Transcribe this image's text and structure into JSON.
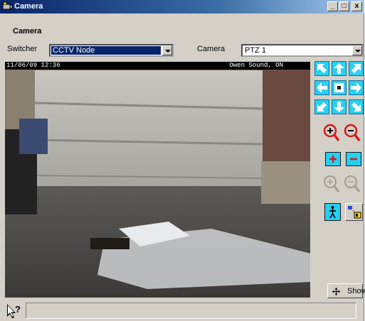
{
  "window": {
    "title": "Camera",
    "min_label": "_",
    "max_label": "□",
    "close_label": "x"
  },
  "header": {
    "section_title": "Camera"
  },
  "controls": {
    "switcher_label": "Switcher",
    "switcher_value": "CCTV Node",
    "camera_label": "Camera",
    "camera_value": "PTZ 1"
  },
  "video": {
    "timestamp": "11/06/09 12:36",
    "location": "Owen Sound, ON"
  },
  "buttons": {
    "show_label": "Show"
  },
  "colors": {
    "ptz_button": "#2ad0f0",
    "zoom_icon": "#d81818",
    "title_bar": "#0a246a"
  },
  "icons": {
    "pan": [
      "arrow-up-left",
      "arrow-up",
      "arrow-up-right",
      "arrow-left",
      "home",
      "arrow-right",
      "arrow-down-left",
      "arrow-down",
      "arrow-down-right"
    ],
    "zoom": [
      "zoom-in",
      "zoom-out",
      "focus-plus",
      "focus-minus",
      "zoom-in-disabled",
      "zoom-out-disabled",
      "person",
      "snapshot"
    ],
    "help": "help-pointer"
  }
}
